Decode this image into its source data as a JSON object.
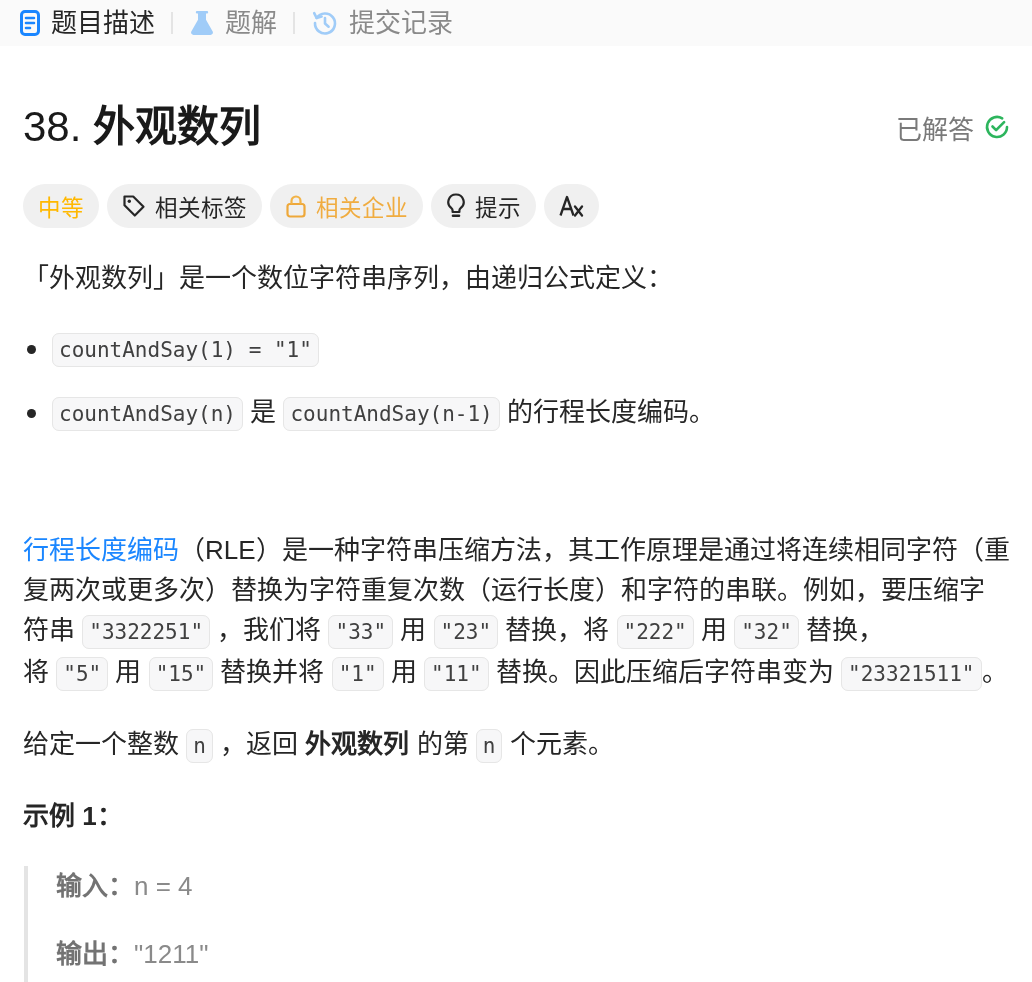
{
  "tabs": [
    {
      "kind": "description",
      "label": "题目描述",
      "selected": true
    },
    {
      "kind": "solution",
      "label": "题解",
      "selected": false
    },
    {
      "kind": "submissions",
      "label": "提交记录",
      "selected": false
    }
  ],
  "problem": {
    "title": "38. **外观数列**",
    "status": "已解答"
  },
  "chips": [
    {
      "kind": "difficulty",
      "label": "中等"
    },
    {
      "kind": "topics",
      "label": "相关标签"
    },
    {
      "kind": "companies",
      "label": "相关企业"
    },
    {
      "kind": "hint",
      "label": "提示"
    },
    {
      "kind": "translate"
    }
  ],
  "description": [
    {
      "kind": "paragraph",
      "parts": [
        {
          "kind": "text",
          "text": "「外观数列」是一个数位字符串序列，由递归公式定义："
        }
      ]
    },
    {
      "kind": "list",
      "items": [
        {
          "parts": [
            {
              "kind": "code",
              "text": "countAndSay(1) = \"1\""
            }
          ]
        },
        {
          "parts": [
            {
              "kind": "code",
              "text": "countAndSay(n)"
            },
            {
              "kind": "text",
              "text": " 是 "
            },
            {
              "kind": "code",
              "text": "countAndSay(n-1)"
            },
            {
              "kind": "text",
              "text": " 的行程长度编码。"
            }
          ]
        }
      ]
    },
    {
      "kind": "paragraph",
      "parts": [
        {
          "kind": "link",
          "text": "行程长度编码"
        },
        {
          "kind": "text",
          "text": "（RLE）是一种字符串压缩方法，其工作原理是通过将连续相同字符（重复两次或更多次）替换为字符重复次数（运行长度）和字符的串联。例如，要压缩字符串 "
        },
        {
          "kind": "code",
          "text": "\"3322251\""
        },
        {
          "kind": "text",
          "text": " ，我们将 "
        },
        {
          "kind": "code",
          "text": "\"33\""
        },
        {
          "kind": "text",
          "text": " 用 "
        },
        {
          "kind": "code",
          "text": "\"23\""
        },
        {
          "kind": "text",
          "text": " 替换，将 "
        },
        {
          "kind": "code",
          "text": "\"222\""
        },
        {
          "kind": "text",
          "text": " 用 "
        },
        {
          "kind": "code",
          "text": "\"32\""
        },
        {
          "kind": "text",
          "text": " 替换，"
        },
        {
          "kind": "break"
        },
        {
          "kind": "text",
          "text": "将 "
        },
        {
          "kind": "code",
          "text": "\"5\""
        },
        {
          "kind": "text",
          "text": " 用 "
        },
        {
          "kind": "code",
          "text": "\"15\""
        },
        {
          "kind": "text",
          "text": " 替换并将 "
        },
        {
          "kind": "code",
          "text": "\"1\""
        },
        {
          "kind": "text",
          "text": " 用 "
        },
        {
          "kind": "code",
          "text": "\"11\""
        },
        {
          "kind": "text",
          "text": " 替换。因此压缩后字符串变为 "
        },
        {
          "kind": "code",
          "text": "\"23321511\""
        },
        {
          "kind": "text",
          "text": "。"
        }
      ]
    },
    {
      "kind": "paragraph",
      "parts": [
        {
          "kind": "text",
          "text": "给定一个整数 "
        },
        {
          "kind": "code",
          "text": "n"
        },
        {
          "kind": "text",
          "text": " ，返回 **外观数列** 的第 "
        },
        {
          "kind": "code",
          "text": "n"
        },
        {
          "kind": "text",
          "text": " 个元素。"
        }
      ]
    }
  ],
  "example": {
    "title": "示例 1：",
    "lines": [
      "**输入：**n = 4",
      "**输出：**\"1211\""
    ]
  }
}
